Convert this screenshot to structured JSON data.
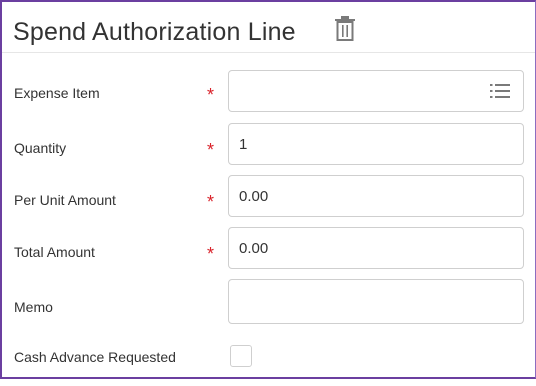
{
  "header": {
    "title": "Spend Authorization Line"
  },
  "form": {
    "expense_item": {
      "label": "Expense Item",
      "required": "*",
      "value": ""
    },
    "quantity": {
      "label": "Quantity",
      "required": "*",
      "value": "1"
    },
    "per_unit_amount": {
      "label": "Per Unit Amount",
      "required": "*",
      "value": "0.00"
    },
    "total_amount": {
      "label": "Total Amount",
      "required": "*",
      "value": "0.00"
    },
    "memo": {
      "label": "Memo",
      "value": ""
    },
    "cash_advance": {
      "label": "Cash Advance Requested",
      "checked": false
    }
  },
  "icons": {
    "delete": "trash-icon",
    "expense_prompt": "list-icon"
  },
  "colors": {
    "border_accent": "#6b3fa0",
    "required": "#d9222a",
    "text": "#333333",
    "icon": "#7a7a7a"
  }
}
